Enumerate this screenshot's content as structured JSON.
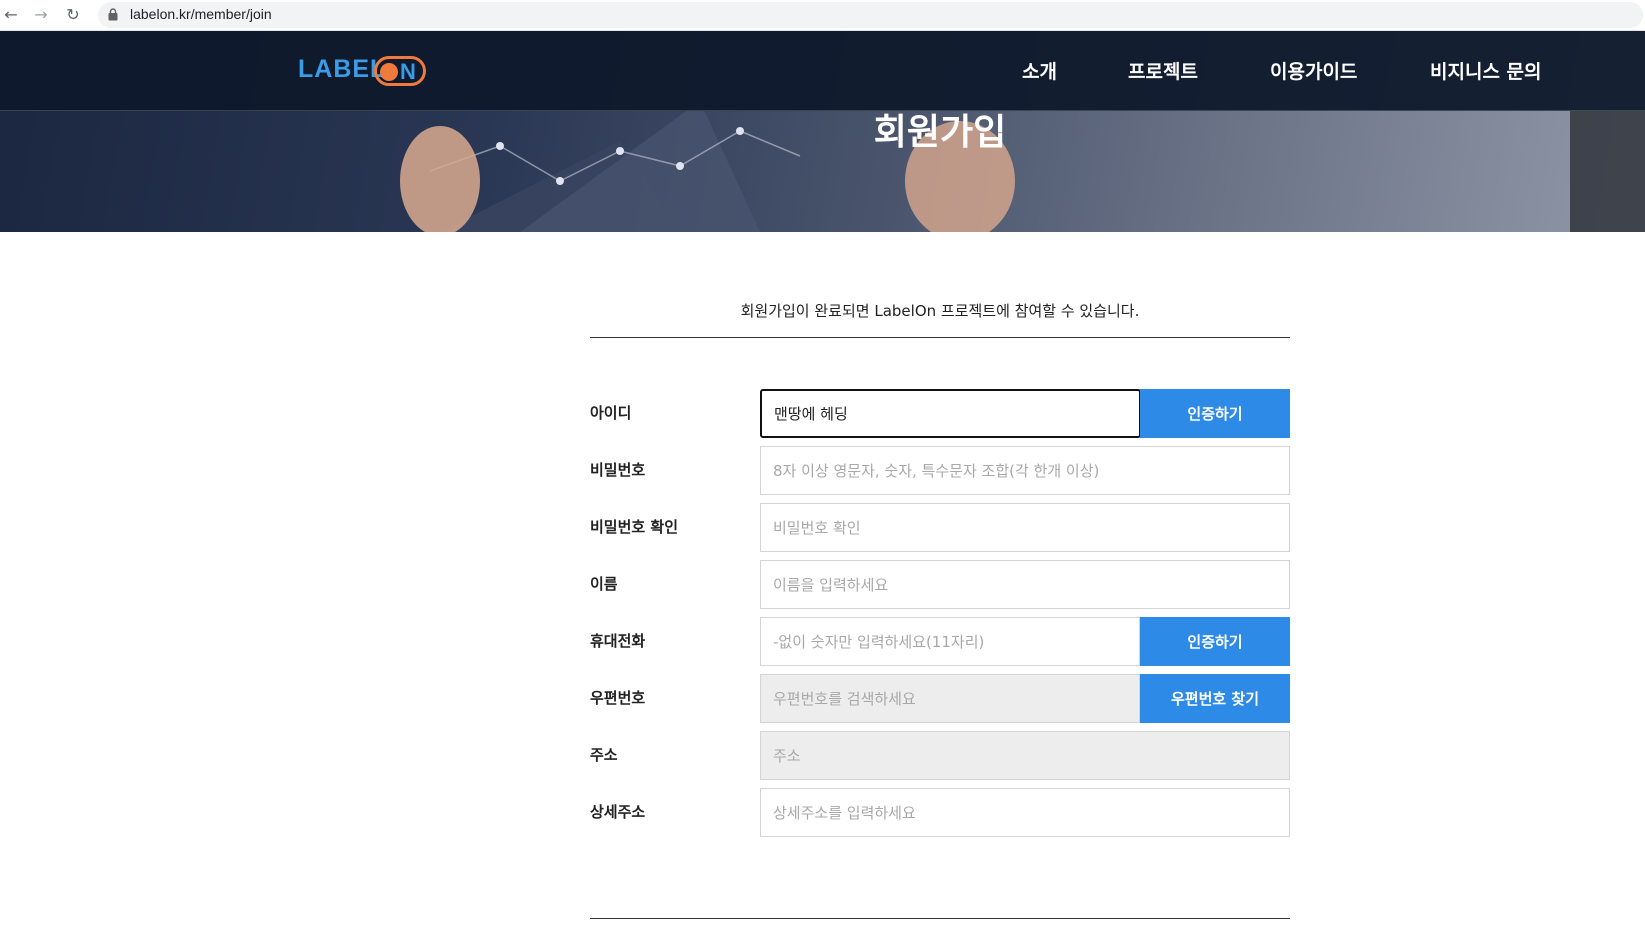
{
  "browser": {
    "url": "labelon.kr/member/join",
    "back_icon": "←",
    "forward_icon": "→",
    "reload_icon": "↻"
  },
  "site": {
    "logo_text": "LABEL ON",
    "nav": [
      "소개",
      "프로젝트",
      "이용가이드",
      "비지니스 문의"
    ]
  },
  "hero": {
    "title": "회원가입"
  },
  "form": {
    "intro": "회원가입이 완료되면 LabelOn 프로젝트에 참여할 수 있습니다.",
    "rows": [
      {
        "label": "아이디",
        "value": "맨땅에 헤딩",
        "placeholder": "",
        "button": "인증하기"
      },
      {
        "label": "비밀번호",
        "value": "",
        "placeholder": "8자 이상 영문자, 숫자, 특수문자 조합(각 한개 이상)"
      },
      {
        "label": "비밀번호 확인",
        "value": "",
        "placeholder": "비밀번호 확인"
      },
      {
        "label": "이름",
        "value": "",
        "placeholder": "이름을 입력하세요"
      },
      {
        "label": "휴대전화",
        "value": "",
        "placeholder": "-없이 숫자만 입력하세요(11자리)",
        "button": "인증하기"
      },
      {
        "label": "우편번호",
        "value": "",
        "placeholder": "우편번호를 검색하세요",
        "button": "우편번호 찾기"
      },
      {
        "label": "주소",
        "value": "",
        "placeholder": "주소"
      },
      {
        "label": "상세주소",
        "value": "",
        "placeholder": "상세주소를 입력하세요"
      }
    ]
  },
  "colors": {
    "accent_blue": "#2d8ae6",
    "logo_blue": "#3a9be6",
    "logo_orange": "#f07a3c",
    "header_bg": "#0e182c"
  }
}
